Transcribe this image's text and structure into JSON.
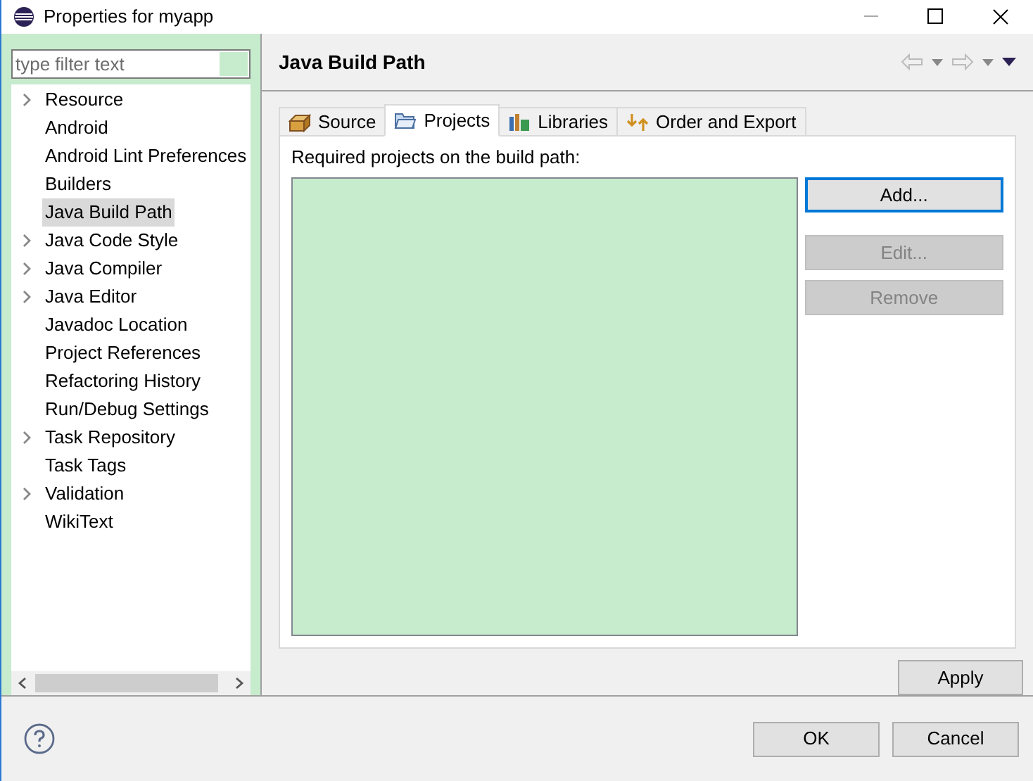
{
  "window": {
    "title": "Properties for myapp"
  },
  "filter": {
    "placeholder": "type filter text"
  },
  "tree": [
    {
      "label": "Resource",
      "expandable": true,
      "selected": false
    },
    {
      "label": "Android",
      "expandable": false,
      "selected": false
    },
    {
      "label": "Android Lint Preferences",
      "expandable": false,
      "selected": false
    },
    {
      "label": "Builders",
      "expandable": false,
      "selected": false
    },
    {
      "label": "Java Build Path",
      "expandable": false,
      "selected": true
    },
    {
      "label": "Java Code Style",
      "expandable": true,
      "selected": false
    },
    {
      "label": "Java Compiler",
      "expandable": true,
      "selected": false
    },
    {
      "label": "Java Editor",
      "expandable": true,
      "selected": false
    },
    {
      "label": "Javadoc Location",
      "expandable": false,
      "selected": false
    },
    {
      "label": "Project References",
      "expandable": false,
      "selected": false
    },
    {
      "label": "Refactoring History",
      "expandable": false,
      "selected": false
    },
    {
      "label": "Run/Debug Settings",
      "expandable": false,
      "selected": false
    },
    {
      "label": "Task Repository",
      "expandable": true,
      "selected": false
    },
    {
      "label": "Task Tags",
      "expandable": false,
      "selected": false
    },
    {
      "label": "Validation",
      "expandable": true,
      "selected": false
    },
    {
      "label": "WikiText",
      "expandable": false,
      "selected": false
    }
  ],
  "page": {
    "title": "Java Build Path",
    "tabs": [
      {
        "label": "Source",
        "kind": "source",
        "selected": false
      },
      {
        "label": "Projects",
        "kind": "projects",
        "selected": true
      },
      {
        "label": "Libraries",
        "kind": "libraries",
        "selected": false
      },
      {
        "label": "Order and Export",
        "kind": "order",
        "selected": false
      }
    ],
    "list_label": "Required projects on the build path:",
    "buttons": [
      {
        "label": "Add...",
        "disabled": false,
        "focused": true
      },
      {
        "label": "Edit...",
        "disabled": true,
        "focused": false
      },
      {
        "label": "Remove",
        "disabled": true,
        "focused": false
      }
    ],
    "apply": "Apply"
  },
  "footer": {
    "buttons": [
      "OK",
      "Cancel"
    ]
  }
}
